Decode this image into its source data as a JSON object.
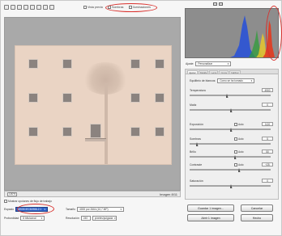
{
  "toolbar": {
    "checkboxes": [
      {
        "label": "Vista previa"
      },
      {
        "label": "Sombras"
      },
      {
        "label": "Iluminaciones"
      }
    ]
  },
  "viewer": {
    "zoom": "100%",
    "status_right": "Imagen 8/11"
  },
  "bottom": {
    "option_label": "Mostrar opciones de flujo de trabajo",
    "espacio_label": "Espacio",
    "espacio_value": "sRGB IEC61966-2.1",
    "tamano_label": "Tamaño",
    "tamano_value": "4000 por 2664 (10,7 MP)",
    "profundidad_label": "Profundidad",
    "profundidad_value": "8 bits/canal",
    "resolucion_label": "Resolución",
    "resolucion_value": "240",
    "resolucion_unit": "píxeles/pulgada",
    "save_button": "Guardar 1 imagen...",
    "open_button": "Abrir 1 imagen",
    "cancel_button": "Cancelar",
    "done_button": "Hecho"
  },
  "histogram": {
    "stats": [
      "R: ---  f/5,6  1/250 s",
      "G: ---  ISO 100",
      "B: ---  18-55 mm"
    ]
  },
  "ajuste": {
    "label": "Ajuste:",
    "value": "Personalizar"
  },
  "panel": {
    "tabs": [
      "Ajustar",
      "Detalle",
      "Lente",
      "Curva",
      "Calibrar"
    ],
    "wb_label": "Equilibrio de blancos:",
    "wb_value": "Como se ha tomado",
    "controls": [
      {
        "label": "Temperatura",
        "value": "4900",
        "auto": "",
        "thumb": 0.45
      },
      {
        "label": "Matiz",
        "value": "0",
        "auto": "",
        "thumb": 0.5
      },
      {
        "label": "Exposición",
        "value": "0,00",
        "auto": "Auto",
        "thumb": 0.5
      },
      {
        "label": "Sombras",
        "value": "5",
        "auto": "Auto",
        "thumb": 0.08
      },
      {
        "label": "Brillo",
        "value": "50",
        "auto": "Auto",
        "thumb": 0.55
      },
      {
        "label": "Contraste",
        "value": "+25",
        "auto": "Auto",
        "thumb": 0.6
      },
      {
        "label": "Saturación",
        "value": "0",
        "auto": "",
        "thumb": 0.5
      }
    ]
  },
  "colors": {
    "histo_blue": "#2a52d6",
    "histo_green": "#2f9d3a",
    "histo_red": "#e23a1f",
    "histo_yellow": "#e6c72c",
    "annotation_red": "#d9302c"
  }
}
